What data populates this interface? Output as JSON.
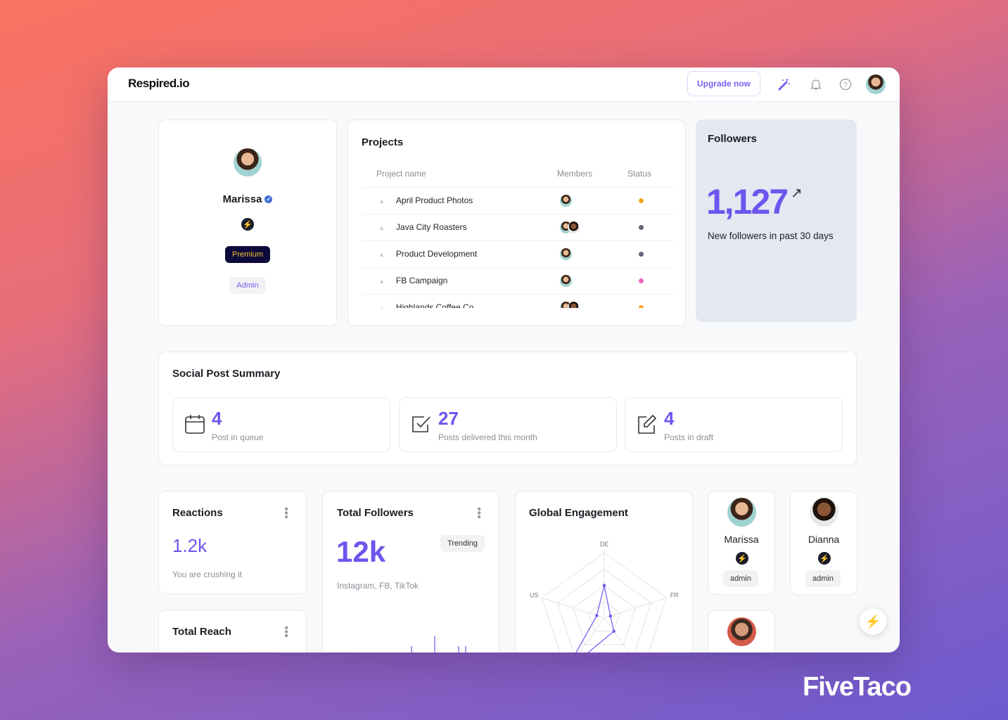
{
  "header": {
    "logo": "Respired.io",
    "upgrade": "Upgrade now",
    "icons": [
      "magic-wand-icon",
      "bell-icon",
      "help-icon",
      "avatar"
    ]
  },
  "profile": {
    "name": "Marissa",
    "verified": true,
    "plan": "Premium",
    "role": "Admin"
  },
  "projects": {
    "title": "Projects",
    "columns": [
      "Project name",
      "Members",
      "Status"
    ],
    "rows": [
      {
        "name": "April Product Photos",
        "members": 1,
        "status_color": "#f5a623"
      },
      {
        "name": "Java City Roasters",
        "members": 2,
        "status_color": "#5f6677"
      },
      {
        "name": "Product Development",
        "members": 1,
        "status_color": "#5f6677"
      },
      {
        "name": "FB Campaign",
        "members": 1,
        "status_color": "#f062c0"
      },
      {
        "name": "Highlands Coffee Co",
        "members": 2,
        "status_color": "#f5a623"
      }
    ]
  },
  "followers": {
    "title": "Followers",
    "value": "1,127",
    "caption": "New followers in past 30 days"
  },
  "social": {
    "title": "Social Post Summary",
    "stats": [
      {
        "icon": "calendar-icon",
        "value": "4",
        "label": "Post in queue"
      },
      {
        "icon": "checkbox-icon",
        "value": "27",
        "label": "Posts delivered this month"
      },
      {
        "icon": "edit-icon",
        "value": "4",
        "label": "Posts in draft"
      }
    ]
  },
  "reactions": {
    "title": "Reactions",
    "value": "1.2k",
    "caption": "You are crushing it"
  },
  "reach": {
    "title": "Total Reach"
  },
  "total_followers": {
    "title": "Total Followers",
    "value": "12k",
    "badge": "Trending",
    "caption": "Instagram, FB, TikTok"
  },
  "engagement": {
    "title": "Global Engagement"
  },
  "chart_data": {
    "type": "radar",
    "axes": [
      "DE",
      "FR",
      "",
      "",
      "US"
    ],
    "values": [
      0.5,
      0.1,
      0.25,
      1.0,
      0.12
    ],
    "range": [
      0,
      1
    ],
    "grid_levels": 4,
    "color": "#6d55ee"
  },
  "people": [
    {
      "name": "Marissa",
      "role": "admin"
    },
    {
      "name": "Dianna",
      "role": "admin"
    },
    {
      "name": "",
      "role": ""
    }
  ],
  "brand": "FiveTaco",
  "colors": {
    "accent": "#6d55ee",
    "premium_bg": "#0d0a3b",
    "premium_text": "#f2c230",
    "followers_bg": "#e3e8f1"
  }
}
